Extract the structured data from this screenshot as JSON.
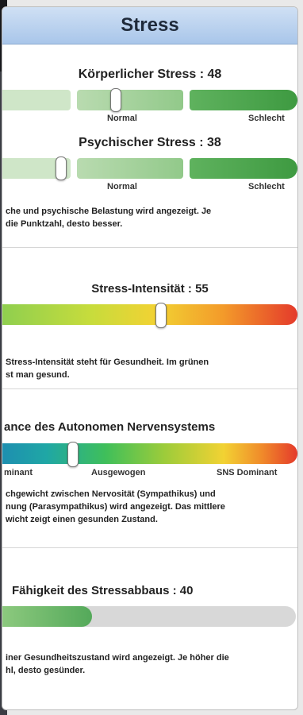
{
  "header": {
    "title": "Stress"
  },
  "koerper": {
    "title": "Körperlicher Stress : 48",
    "value": 48,
    "label_normal": "Normal",
    "label_schlecht": "Schlecht"
  },
  "psych": {
    "title": "Psychischer Stress : 38",
    "value": 38,
    "label_normal": "Normal",
    "label_schlecht": "Schlecht",
    "desc1": "che und psychische Belastung wird angezeigt. Je",
    "desc2": "die Punktzahl, desto besser."
  },
  "intensity": {
    "title": "Stress-Intensität : 55",
    "value": 55,
    "desc1": "Stress-Intensität steht für Gesundheit. Im grünen",
    "desc2": "st man gesund."
  },
  "ans": {
    "title": "ance des Autonomen Nervensystems",
    "label_left": "minant",
    "label_mid": "Ausgewogen",
    "label_right": "SNS Dominant",
    "desc1": "chgewicht zwischen Nervosität (Sympathikus) und",
    "desc2": "nung (Parasympathikus) wird angezeigt. Das mittlere",
    "desc3": "wicht zeigt einen gesunden Zustand."
  },
  "recovery": {
    "title": "Fähigkeit des Stressabbaus : 40",
    "value": 40,
    "desc1": "iner Gesundheitszustand wird angezeigt. Je höher die",
    "desc2": "hl, desto gesünder."
  },
  "colors": {
    "header_bg": "#b9d1ee",
    "green_light": "#c8e2c0",
    "green_dark": "#3e9a41",
    "red": "#e43a2b",
    "yellow": "#f2d233",
    "teal": "#1fa7a5"
  }
}
